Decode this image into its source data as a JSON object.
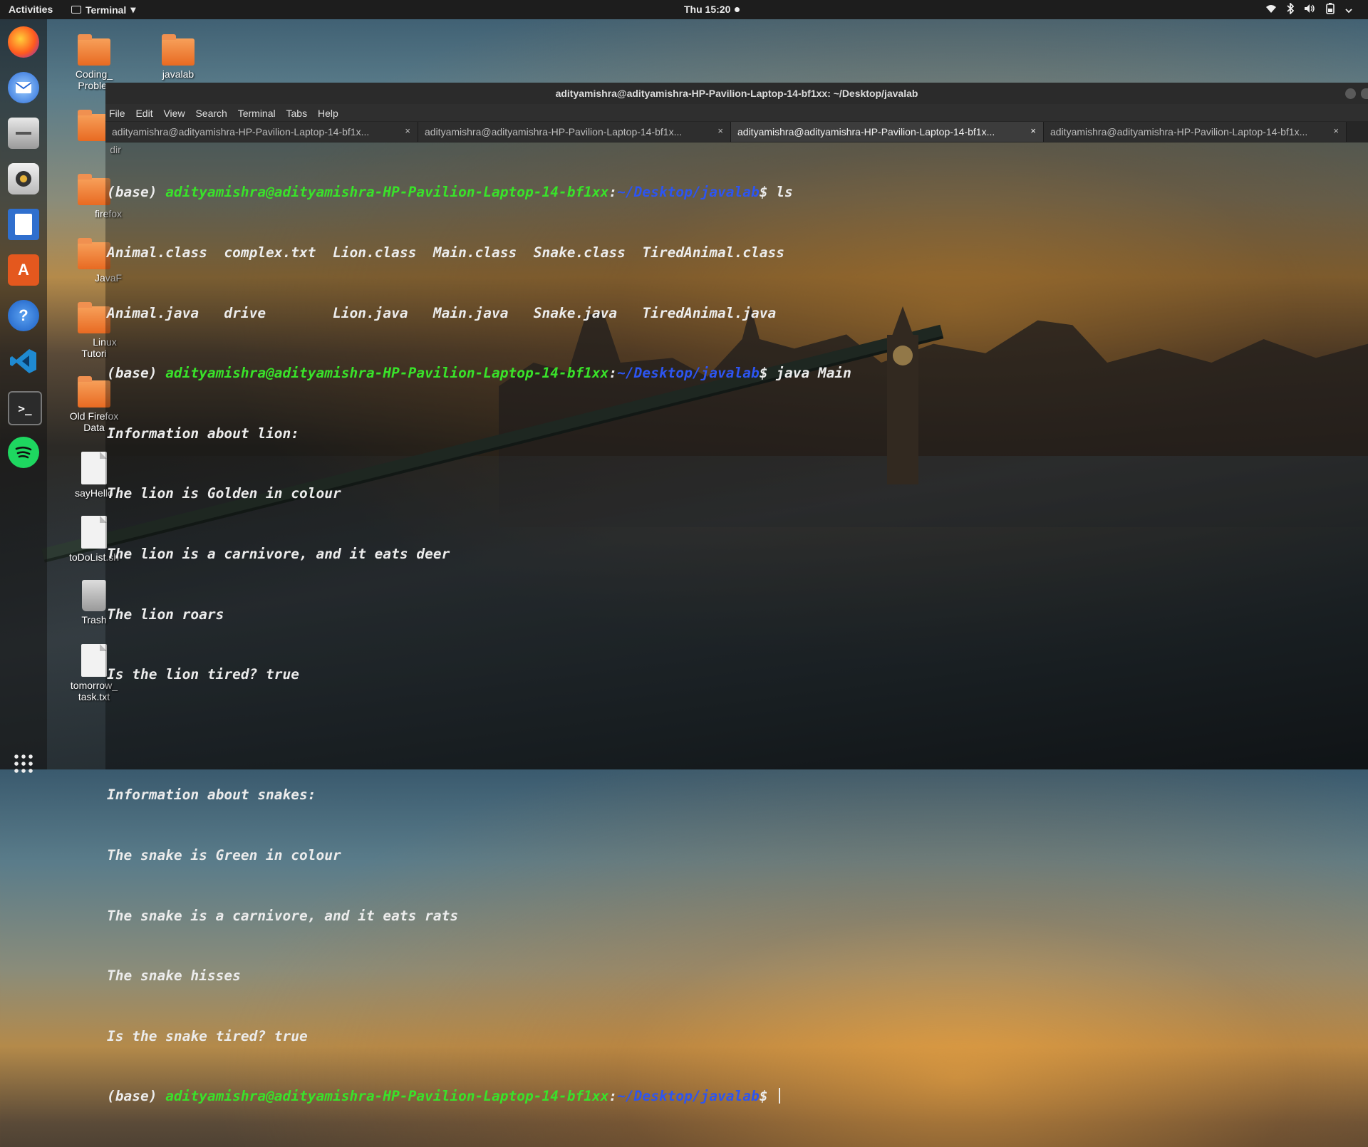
{
  "topbar": {
    "activities": "Activities",
    "app_name": "Terminal",
    "app_caret": "▾",
    "clock": "Thu 15:20",
    "tray_icons": [
      "wifi-icon",
      "bluetooth-icon",
      "volume-icon",
      "battery-icon",
      "chevron-down-icon"
    ]
  },
  "dock": {
    "apps": [
      "firefox",
      "thunderbird",
      "files",
      "rhythmbox",
      "writer",
      "software-center",
      "help",
      "vscode",
      "terminal",
      "spotify",
      "show-applications"
    ]
  },
  "desktop": {
    "icons": [
      {
        "label": "Coding_\nProbler",
        "type": "folder"
      },
      {
        "label": "javalab",
        "type": "folder"
      },
      {
        "label": "dir",
        "type": "folder"
      },
      {
        "label": "firefox",
        "type": "folder"
      },
      {
        "label": "JavaF",
        "type": "folder"
      },
      {
        "label": "Linux\nTutori",
        "type": "folder"
      },
      {
        "label": "Old Firefox\nData",
        "type": "folder"
      },
      {
        "label": "sayHello",
        "type": "file"
      },
      {
        "label": "toDoList.sh",
        "type": "file"
      },
      {
        "label": "Trash",
        "type": "trash"
      },
      {
        "label": "tomorrow_\ntask.txt",
        "type": "file"
      }
    ]
  },
  "window": {
    "title": "adityamishra@adityamishra-HP-Pavilion-Laptop-14-bf1xx: ~/Desktop/javalab",
    "menu": [
      "File",
      "Edit",
      "View",
      "Search",
      "Terminal",
      "Tabs",
      "Help"
    ],
    "tabs": [
      {
        "label": "adityamishra@adityamishra-HP-Pavilion-Laptop-14-bf1x...",
        "close": "×",
        "active": false
      },
      {
        "label": "adityamishra@adityamishra-HP-Pavilion-Laptop-14-bf1x...",
        "close": "×",
        "active": false
      },
      {
        "label": "adityamishra@adityamishra-HP-Pavilion-Laptop-14-bf1x...",
        "close": "×",
        "active": true
      },
      {
        "label": "adityamishra@adityamishra-HP-Pavilion-Laptop-14-bf1x...",
        "close": "×",
        "active": false
      }
    ]
  },
  "terminal": {
    "prompt_env": "(base) ",
    "prompt_user": "adityamishra@adityamishra-HP-Pavilion-Laptop-14-bf1xx",
    "prompt_colon": ":",
    "prompt_path": "~/Desktop/javalab",
    "prompt_dollar": "$ ",
    "cmd1": "ls",
    "ls_row1": "Animal.class  complex.txt  Lion.class  Main.class  Snake.class  TiredAnimal.class",
    "ls_row2": "Animal.java   drive        Lion.java   Main.java   Snake.java   TiredAnimal.java",
    "cmd2": "java Main",
    "output": [
      "Information about lion:",
      "The lion is Golden in colour",
      "The lion is a carnivore, and it eats deer",
      "The lion roars",
      "Is the lion tired? true",
      "",
      "Information about snakes:",
      "The snake is Green in colour",
      "The snake is a carnivore, and it eats rats",
      "The snake hisses",
      "Is the snake tired? true"
    ]
  },
  "colors": {
    "prompt_user": "#39e22a",
    "prompt_path": "#2d55f0",
    "text": "#ececec",
    "folder": "#e86a22"
  }
}
